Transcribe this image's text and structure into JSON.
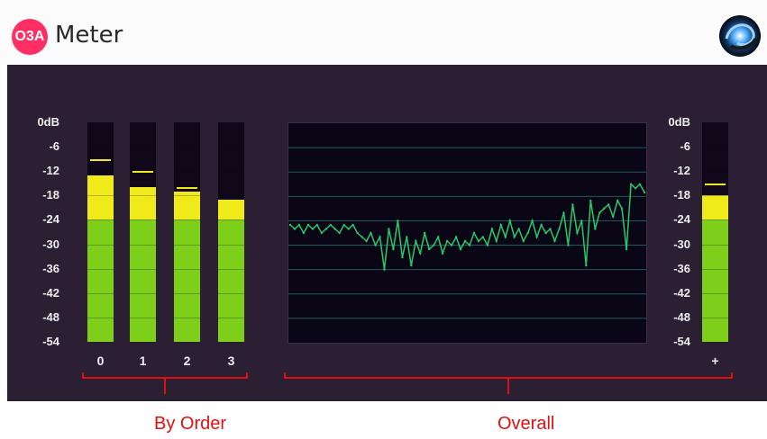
{
  "app": {
    "badge": "O3A",
    "title": "Meter"
  },
  "scale_left": [
    "0dB",
    "-6",
    "-12",
    "-18",
    "-24",
    "-30",
    "-36",
    "-42",
    "-48",
    "-54"
  ],
  "scale_right": [
    "0dB",
    "-6",
    "-12",
    "-18",
    "-24",
    "-30",
    "-36",
    "-42",
    "-48",
    "-54"
  ],
  "meters": [
    {
      "label": "0",
      "level_db": -13,
      "peak_db": -9
    },
    {
      "label": "1",
      "level_db": -16,
      "peak_db": -12
    },
    {
      "label": "2",
      "level_db": -17,
      "peak_db": -16
    },
    {
      "label": "3",
      "level_db": -19,
      "peak_db": null
    }
  ],
  "overall_meter": {
    "label": "+",
    "level_db": -18,
    "peak_db": -15
  },
  "captions": {
    "by_order": "By Order",
    "overall": "Overall"
  },
  "colors": {
    "badge": "#ff2e63",
    "panel": "#2a1f33",
    "meter_green": "#7ecf1a",
    "meter_yellow": "#f1ea1a",
    "spectrum_line": "#27c96b",
    "caption": "#e01010"
  },
  "icons": {
    "logo": "swirl-logo-icon"
  },
  "chart_data": {
    "type": "line",
    "series": [
      {
        "x": [
          0,
          5,
          10,
          15,
          20,
          25,
          30,
          35,
          40,
          45,
          50,
          55,
          60,
          65,
          70,
          75,
          80,
          85,
          90,
          95,
          100,
          105,
          110,
          115,
          120,
          125,
          130,
          135,
          140,
          145,
          150,
          155,
          160,
          165,
          170,
          175,
          180,
          185,
          190,
          195,
          200,
          205,
          210,
          215,
          220,
          225,
          230,
          235,
          240,
          245,
          250,
          255,
          260,
          265,
          270,
          275,
          280,
          285,
          290,
          295,
          300,
          305,
          310,
          315,
          320,
          325,
          330,
          335,
          340,
          345,
          350,
          355,
          360,
          365,
          370,
          375,
          380,
          385,
          390,
          395
        ],
        "y": [
          -25,
          -26,
          -25,
          -27,
          -25,
          -26,
          -25,
          -27,
          -26,
          -25,
          -26,
          -27,
          -25,
          -26,
          -25,
          -27,
          -28,
          -29,
          -27,
          -30,
          -28,
          -36,
          -26,
          -31,
          -24,
          -33,
          -28,
          -35,
          -29,
          -32,
          -27,
          -31,
          -30,
          -28,
          -32,
          -29,
          -30,
          -28,
          -31,
          -29,
          -30,
          -27,
          -29,
          -28,
          -30,
          -26,
          -29,
          -25,
          -28,
          -24,
          -28,
          -26,
          -29,
          -27,
          -24,
          -28,
          -25,
          -27,
          -26,
          -29,
          -26,
          -22,
          -30,
          -20,
          -27,
          -24,
          -35,
          -19,
          -26,
          -22,
          -21,
          -20,
          -23,
          -19,
          -21,
          -31,
          -15,
          -16,
          -15,
          -17
        ]
      }
    ],
    "ylim": [
      -54,
      0
    ],
    "grid": true
  }
}
